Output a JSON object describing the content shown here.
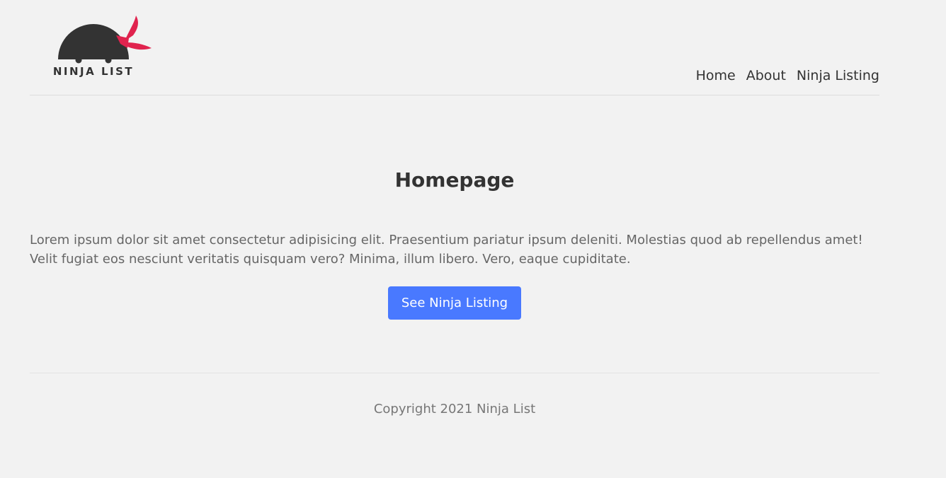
{
  "brand": {
    "logo_text": "NINJA LIST",
    "colors": {
      "dark": "#333333",
      "bandana": "#e0234e"
    }
  },
  "nav": {
    "items": [
      {
        "label": "Home"
      },
      {
        "label": "About"
      },
      {
        "label": "Ninja Listing"
      }
    ]
  },
  "main": {
    "title": "Homepage",
    "paragraph": "Lorem ipsum dolor sit amet consectetur adipisicing elit. Praesentium pariatur ipsum deleniti. Molestias quod ab repellendus amet! Velit fugiat eos nesciunt veritatis quisquam vero? Minima, illum libero. Vero, eaque cupiditate.",
    "cta_label": "See Ninja Listing",
    "accent": "#4979ff"
  },
  "footer": {
    "copyright": "Copyright 2021 Ninja List"
  }
}
